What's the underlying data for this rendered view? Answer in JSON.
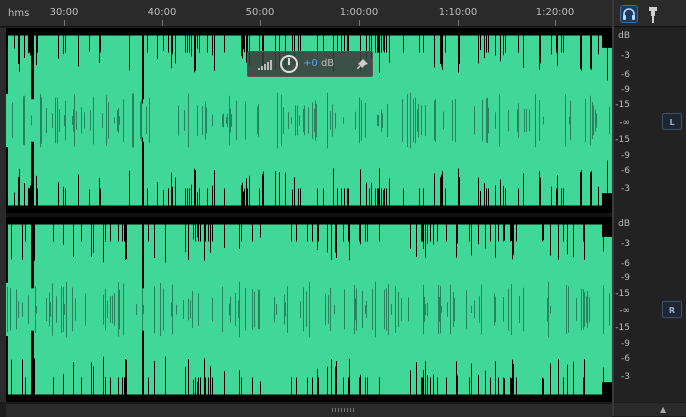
{
  "ruler": {
    "units": "hms",
    "ticks": [
      "30:00",
      "40:00",
      "50:00",
      "1:00:00",
      "1:10:00",
      "1:20:00"
    ]
  },
  "hud": {
    "plus": "+0",
    "unit": "dB"
  },
  "amp": {
    "labels": [
      "dB",
      "-3",
      "-6",
      "-9",
      "-15",
      "-∞",
      "-15",
      "-9",
      "-6",
      "-3"
    ],
    "channels": [
      "L",
      "R"
    ]
  },
  "colors": {
    "waveform": "#40d898",
    "background": "#000000"
  },
  "icons": [
    "headphones-icon",
    "pin-icon",
    "volume-bars-icon",
    "volume-knob-icon",
    "hud-pin-icon",
    "scroll-grip-icon",
    "scroll-up-icon"
  ]
}
